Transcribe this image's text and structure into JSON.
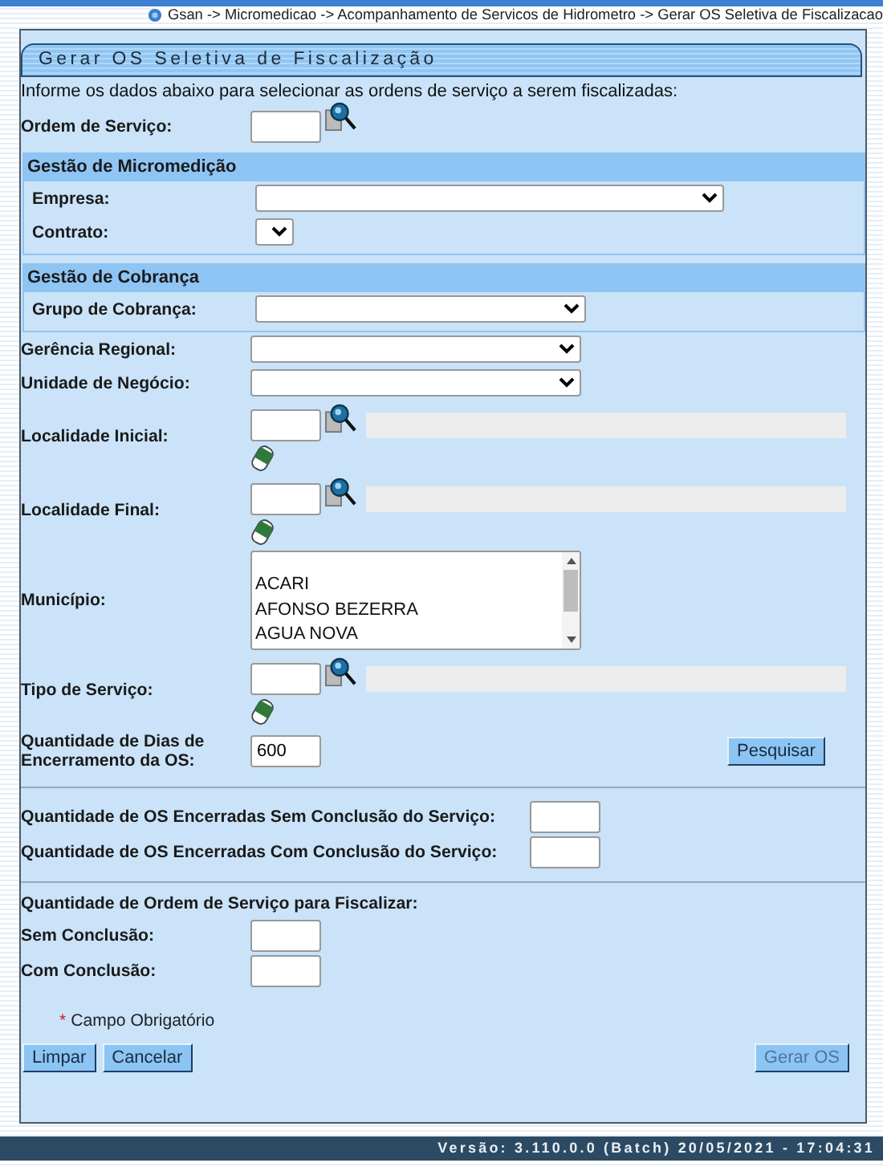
{
  "breadcrumb": "Gsan -> Micromedicao -> Acompanhamento de Servicos de Hidrometro -> Gerar OS Seletiva de Fiscalizacao",
  "title": "Gerar OS Seletiva de Fiscalização",
  "intro": "Informe os dados abaixo para selecionar as ordens de serviço a serem fiscalizadas:",
  "ordem_servico": {
    "label": "Ordem de Serviço:"
  },
  "micromedicao": {
    "title": "Gestão de Micromedição",
    "empresa": {
      "label": "Empresa:"
    },
    "contrato": {
      "label": "Contrato:"
    }
  },
  "cobranca": {
    "title": "Gestão de Cobrança",
    "grupo": {
      "label": "Grupo de Cobrança:"
    }
  },
  "gerencia_regional": {
    "label": "Gerência Regional:"
  },
  "unidade_negocio": {
    "label": "Unidade de Negócio:"
  },
  "localidade_inicial": {
    "label": "Localidade Inicial:"
  },
  "localidade_final": {
    "label": "Localidade Final:"
  },
  "municipio": {
    "label": "Município:",
    "options": [
      "ACARI",
      "AFONSO BEZERRA",
      "AGUA NOVA"
    ]
  },
  "tipo_servico": {
    "label": "Tipo de Serviço:"
  },
  "dias_encerramento": {
    "label": "Quantidade de Dias de Encerramento da OS:",
    "value": "600"
  },
  "pesquisar": "Pesquisar",
  "encerradas_sem": {
    "label": "Quantidade de OS Encerradas Sem Conclusão do Serviço:"
  },
  "encerradas_com": {
    "label": "Quantidade de OS Encerradas Com Conclusão do Serviço:"
  },
  "fiscalizar": {
    "heading": "Quantidade de Ordem de Serviço para Fiscalizar:",
    "sem": {
      "label": "Sem Conclusão:"
    },
    "com": {
      "label": "Com Conclusão:"
    }
  },
  "required_note": {
    "mark": "*",
    "text": "Campo Obrigatório"
  },
  "buttons": [
    {
      "label": "Limpar",
      "disabled": false
    },
    {
      "label": "Cancelar",
      "disabled": false
    },
    {
      "label": "Gerar OS",
      "disabled": true
    }
  ],
  "version": "Versão: 3.110.0.0 (Batch) 20/05/2021 - 17:04:31"
}
